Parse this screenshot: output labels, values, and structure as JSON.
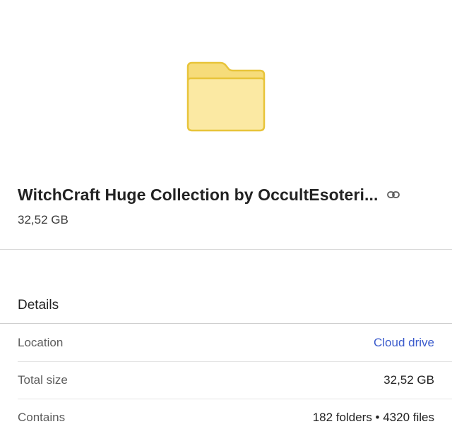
{
  "file": {
    "icon": "folder-icon",
    "title": "WitchCraft Huge Collection by OccultEsoteri...",
    "size": "32,52 GB",
    "link_icon": "link-icon"
  },
  "details": {
    "heading": "Details",
    "rows": [
      {
        "label": "Location",
        "value": "Cloud drive"
      },
      {
        "label": "Total size",
        "value": "32,52 GB"
      },
      {
        "label": "Contains",
        "value": "182 folders • 4320 files"
      }
    ]
  },
  "colors": {
    "folder_fill": "#fbe9a3",
    "folder_stroke": "#e8c43a",
    "link": "#3b5bcc"
  }
}
